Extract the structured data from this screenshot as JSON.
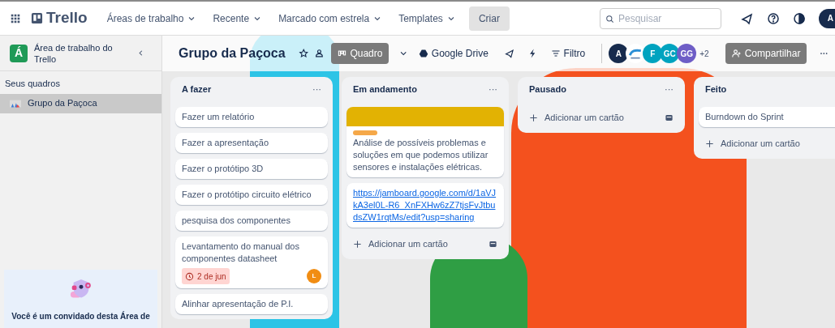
{
  "topbar": {
    "logo": "Trello",
    "menus": [
      {
        "label": "Áreas de trabalho"
      },
      {
        "label": "Recente"
      },
      {
        "label": "Marcado com estrela"
      },
      {
        "label": "Templates"
      }
    ],
    "create": "Criar",
    "search": {
      "placeholder": "Pesquisar"
    },
    "avatar": "A"
  },
  "sidebar": {
    "workspace_initial": "Á",
    "workspace_name": "Área de trabalho do Trello",
    "section": "Seus quadros",
    "boards": [
      {
        "label": "Grupo da Paçoca",
        "selected": true
      }
    ],
    "guest_notice": "Você é um convidado desta Área de"
  },
  "board": {
    "title": "Grupo da Paçoca",
    "view": "Quadro",
    "powerup": "Google Drive",
    "filter": "Filtro",
    "members": [
      {
        "initials": "A",
        "color": "#172b4d",
        "kind": "initials"
      },
      {
        "color": "#ffffff",
        "kind": "image"
      },
      {
        "initials": "F",
        "color": "#00a3bf",
        "kind": "initials"
      },
      {
        "initials": "GC",
        "color": "#00a3bf",
        "kind": "initials"
      },
      {
        "initials": "GG",
        "color": "#6e5dc6",
        "kind": "initials"
      }
    ],
    "more_members": "+2",
    "share": "Compartilhar"
  },
  "lists": [
    {
      "title": "A fazer",
      "menu": "···",
      "cards": [
        {
          "kind": "text",
          "text": "Fazer um relatório"
        },
        {
          "kind": "text",
          "text": "Fazer a apresentação"
        },
        {
          "kind": "text",
          "text": "Fazer o protótipo 3D"
        },
        {
          "kind": "text",
          "text": "Fazer o protótipo circuito elétrico"
        },
        {
          "kind": "text",
          "text": "pesquisa dos componentes"
        },
        {
          "kind": "text",
          "text": "Levantamento do manual dos componentes datasheet",
          "due": "2 de jun",
          "overdue": true,
          "member": "L"
        },
        {
          "kind": "text",
          "text": "Alinhar apresentação de P.I."
        }
      ]
    },
    {
      "title": "Em andamento",
      "menu": "···",
      "cards": [
        {
          "kind": "cover",
          "cover": {
            "color": "#e2b203"
          },
          "label": {
            "color": "#f5a849"
          },
          "text": "Análise de possíveis problemas e soluções em que podemos utilizar sensores e instalações elétricas."
        },
        {
          "kind": "link",
          "text": "https://jamboard.google.com/d/1aVJkA3el0L-R6_XnFXHw6zZ7tjsFvJtbudsZW1rqtMs/edit?usp=sharing"
        }
      ],
      "add": "Adicionar um cartão"
    },
    {
      "title": "Pausado",
      "menu": "···",
      "add": "Adicionar um cartão"
    },
    {
      "title": "Feito",
      "cards": [
        {
          "kind": "text",
          "text": "Burndown do Sprint"
        }
      ],
      "add": "Adicionar um cartão"
    }
  ]
}
